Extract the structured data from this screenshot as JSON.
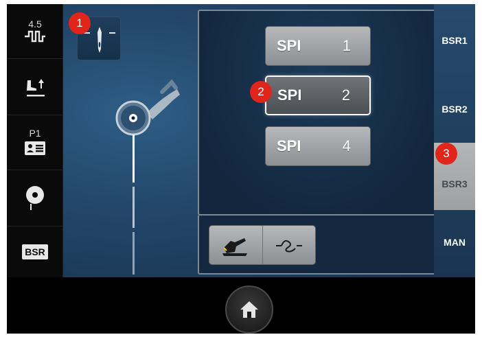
{
  "left_toolbar": {
    "stitch_length_value": "4.5",
    "pattern_label": "P1",
    "bsr_label": "BSR"
  },
  "badges": [
    "1",
    "2",
    "3"
  ],
  "spi_buttons": [
    {
      "label": "SPI",
      "value": "1",
      "selected": false
    },
    {
      "label": "SPI",
      "value": "2",
      "selected": true
    },
    {
      "label": "SPI",
      "value": "4",
      "selected": false
    }
  ],
  "modes": [
    {
      "label": "BSR1",
      "active": false
    },
    {
      "label": "BSR2",
      "active": false
    },
    {
      "label": "BSR3",
      "active": true
    },
    {
      "label": "MAN",
      "active": false
    }
  ],
  "icons": {
    "stitch_length": "stitch-length-icon",
    "presser_foot": "presser-foot-lift-icon",
    "pattern_card": "pattern-card-icon",
    "bobbin": "bobbin-icon",
    "needle": "needle-position-icon",
    "foot_control": "foot-control-icon",
    "thread_cutter": "thread-cutter-icon",
    "home": "home-icon"
  },
  "colors": {
    "badge": "#e0251b",
    "panel_blue": "#23476a",
    "button_gray": "#a3a6a9"
  }
}
